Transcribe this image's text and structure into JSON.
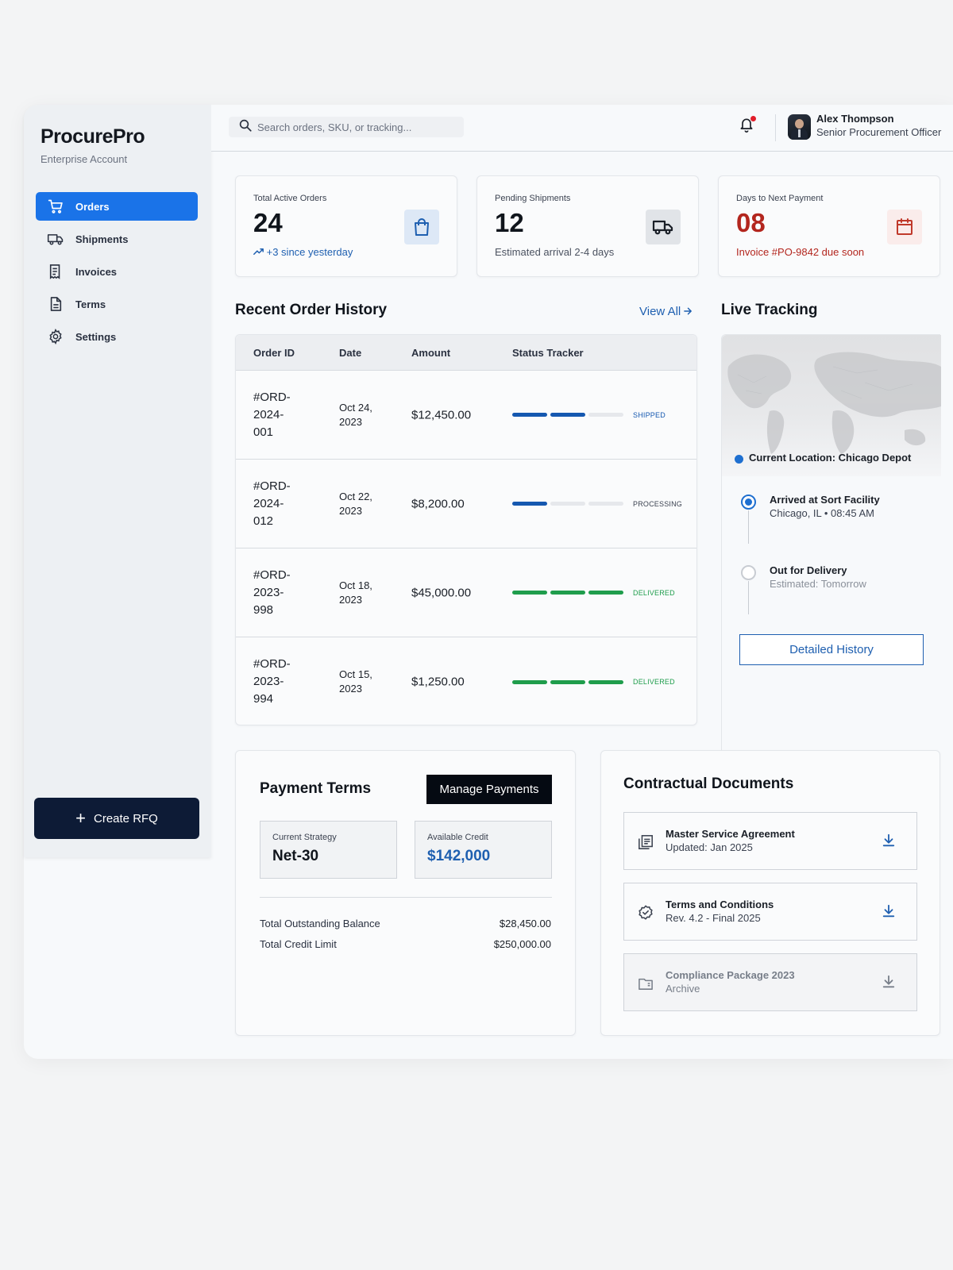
{
  "brand": {
    "name": "ProcurePro",
    "subtitle": "Enterprise Account"
  },
  "sidebar": {
    "items": [
      {
        "label": "Orders",
        "icon": "cart-icon",
        "active": true
      },
      {
        "label": "Shipments",
        "icon": "truck-icon",
        "active": false
      },
      {
        "label": "Invoices",
        "icon": "receipt-icon",
        "active": false
      },
      {
        "label": "Terms",
        "icon": "document-icon",
        "active": false
      },
      {
        "label": "Settings",
        "icon": "gear-icon",
        "active": false
      }
    ],
    "create_button": "Create RFQ"
  },
  "header": {
    "search_placeholder": "Search orders, SKU, or tracking...",
    "user_name": "Alex Thompson",
    "user_role": "Senior Procurement Officer",
    "has_notification": true
  },
  "stats": [
    {
      "label": "Total Active Orders",
      "value": "24",
      "sub": "+3 since yesterday",
      "icon": "shopping-bag-icon"
    },
    {
      "label": "Pending Shipments",
      "value": "12",
      "sub": "Estimated arrival 2-4 days",
      "icon": "truck-icon"
    },
    {
      "label": "Days to Next Payment",
      "value": "08",
      "sub": "Invoice #PO-9842 due soon",
      "icon": "calendar-icon"
    }
  ],
  "orders": {
    "title": "Recent Order History",
    "view_all": "View All",
    "columns": [
      "Order ID",
      "Date",
      "Amount",
      "Status Tracker"
    ],
    "rows": [
      {
        "id": "#ORD-2024-001",
        "date": "Oct 24, 2023",
        "amount": "$12,450.00",
        "progress": 2,
        "status": "SHIPPED"
      },
      {
        "id": "#ORD-2024-012",
        "date": "Oct 22, 2023",
        "amount": "$8,200.00",
        "progress": 1,
        "status": "PROCESSING"
      },
      {
        "id": "#ORD-2023-998",
        "date": "Oct 18, 2023",
        "amount": "$45,000.00",
        "progress": 3,
        "status": "DELIVERED"
      },
      {
        "id": "#ORD-2023-994",
        "date": "Oct 15, 2023",
        "amount": "$1,250.00",
        "progress": 3,
        "status": "DELIVERED"
      }
    ]
  },
  "tracking": {
    "title": "Live Tracking",
    "current_location": "Current Location: Chicago Depot",
    "events": [
      {
        "title": "Arrived at Sort Facility",
        "sub": "Chicago, IL • 08:45 AM"
      },
      {
        "title": "Out for Delivery",
        "sub": "Estimated: Tomorrow"
      }
    ],
    "history_button": "Detailed History"
  },
  "payment": {
    "title": "Payment Terms",
    "manage_button": "Manage Payments",
    "strategy_label": "Current Strategy",
    "strategy_value": "Net-30",
    "credit_label": "Available Credit",
    "credit_value": "$142,000",
    "outstanding_label": "Total Outstanding Balance",
    "outstanding_value": "$28,450.00",
    "limit_label": "Total Credit Limit",
    "limit_value": "$250,000.00"
  },
  "documents": {
    "title": "Contractual Documents",
    "items": [
      {
        "title": "Master Service Agreement",
        "sub": "Updated: Jan 2025",
        "icon": "document-stack-icon"
      },
      {
        "title": "Terms and Conditions",
        "sub": "Rev. 4.2 - Final 2025",
        "icon": "verified-badge-icon"
      },
      {
        "title": "Compliance Package 2023",
        "sub": "Archive",
        "icon": "folder-icon"
      }
    ]
  },
  "colors": {
    "primary": "#1a73e8",
    "navy": "#0d1b36",
    "shipped": "#1558b0",
    "delivered": "#1f9d4c",
    "alert": "#b3261e"
  }
}
